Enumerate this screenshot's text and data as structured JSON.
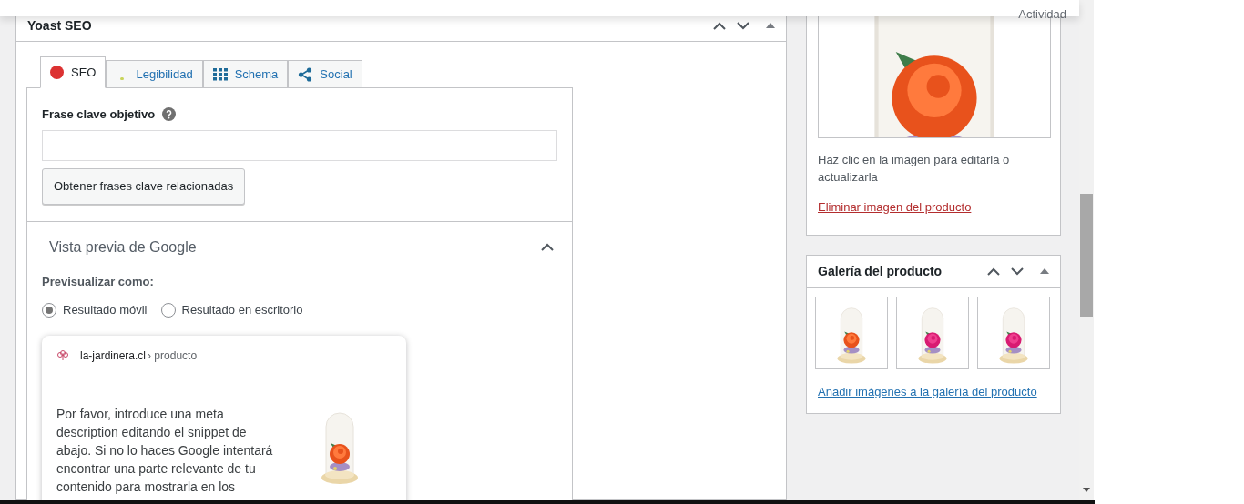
{
  "top_bar": {
    "label": "Actividad"
  },
  "yoast": {
    "title": "Yoast SEO",
    "tabs": [
      {
        "label": "SEO",
        "selected": true,
        "kind": "score",
        "color": "#dc3232"
      },
      {
        "label": "Legibilidad",
        "selected": false,
        "kind": "score",
        "color": "#c8d45a"
      },
      {
        "label": "Schema",
        "selected": false,
        "kind": "grid"
      },
      {
        "label": "Social",
        "selected": false,
        "kind": "share"
      }
    ],
    "focus_keyphrase": {
      "label": "Frase clave objetivo"
    },
    "related_button": "Obtener frases clave relacionadas",
    "google_preview": {
      "title": "Vista previa de Google",
      "expanded": true,
      "preview_as_label": "Previsualizar como:",
      "options": [
        {
          "label": "Resultado móvil",
          "selected": true
        },
        {
          "label": "Resultado en escritorio",
          "selected": false
        }
      ],
      "snippet": {
        "site": "la-jardinera.cl",
        "breadcrumb": "› producto",
        "description": "Por favor, introduce una meta description editando el snippet de abajo. Si no lo haces Google intentará encontrar una parte relevante de tu contenido para mostrarla en los"
      }
    }
  },
  "product_image": {
    "hint": "Haz clic en la imagen para editarla o actualizarla",
    "remove_link": "Eliminar imagen del producto"
  },
  "gallery": {
    "title": "Galería del producto",
    "add_link": "Añadir imágenes a la galería del producto"
  }
}
